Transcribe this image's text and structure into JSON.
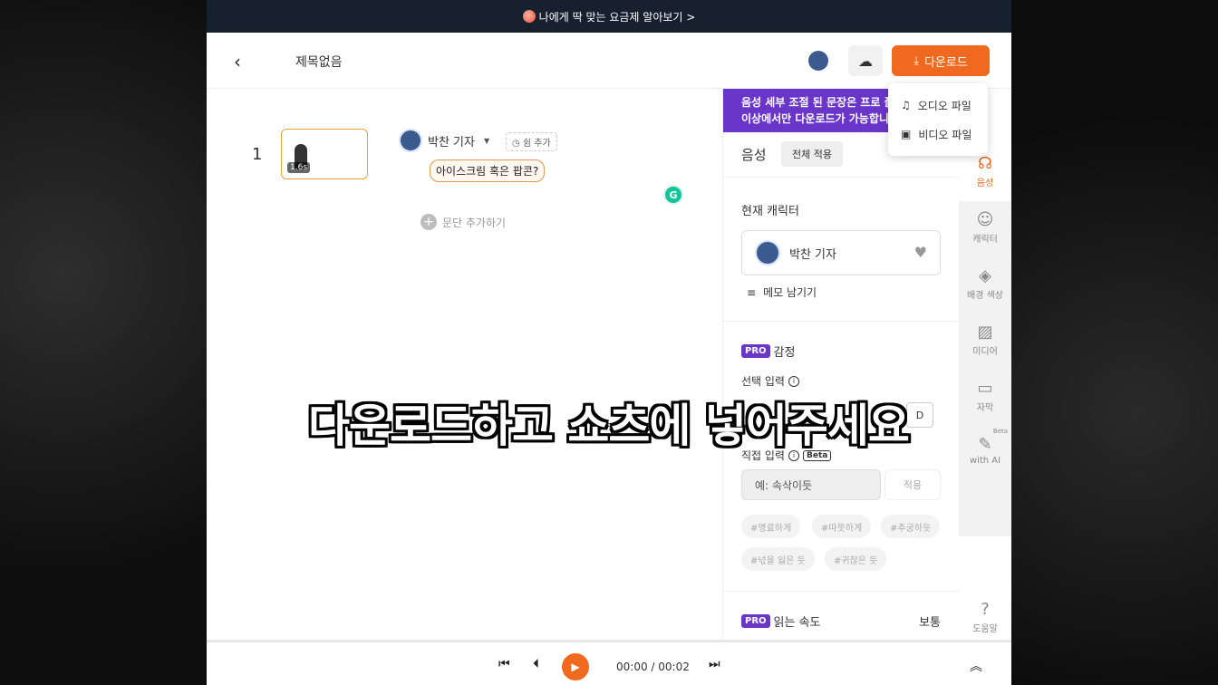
{
  "promo": {
    "text": "나에게 딱 맞는 요금제 알아보기 >"
  },
  "header": {
    "title": "제목없음",
    "download_label": "다운로드"
  },
  "download_menu": {
    "audio": "오디오 파일",
    "video": "비디오 파일"
  },
  "editor": {
    "row_number": "1",
    "thumb_badge": "1.6s",
    "speaker_name": "박찬 기자",
    "pause_add": "쉼 추가",
    "sentence": "아이스크림 혹은 팝콘?",
    "add_paragraph": "문단 추가하기"
  },
  "panel": {
    "notice_line1": "음성 세부 조절 된 문장은 프로 플",
    "notice_line2": "이상에서만 다운로드가 가능합니",
    "voice_title": "음성",
    "apply_all": "전체 적용",
    "current_character": "현재 캐릭터",
    "character_name": "박찬 기자",
    "memo": "메모 남기기",
    "pro_tag": "PRO",
    "emotion": "감정",
    "select_input": "선택 입력",
    "d_button": "D",
    "direct_input": "직접 입력",
    "beta": "Beta",
    "direct_placeholder": "예: 속삭이듯",
    "direct_apply": "적용",
    "chips": [
      "#명료하게",
      "#따뜻하게",
      "#추궁하듯",
      "#넋을 잃은 듯",
      "#귀찮은 듯"
    ],
    "speed_label": "읽는 속도",
    "speed_value": "보통"
  },
  "rail": {
    "voice": "음성",
    "character": "캐릭터",
    "bg_color": "배경 색상",
    "media": "미디어",
    "subtitle": "자막",
    "with_ai": "with AI",
    "beta": "Beta",
    "help": "도움말"
  },
  "player": {
    "time": "00:00 / 00:02"
  },
  "caption": "다운로드하고 쇼츠에 넣어주세요"
}
